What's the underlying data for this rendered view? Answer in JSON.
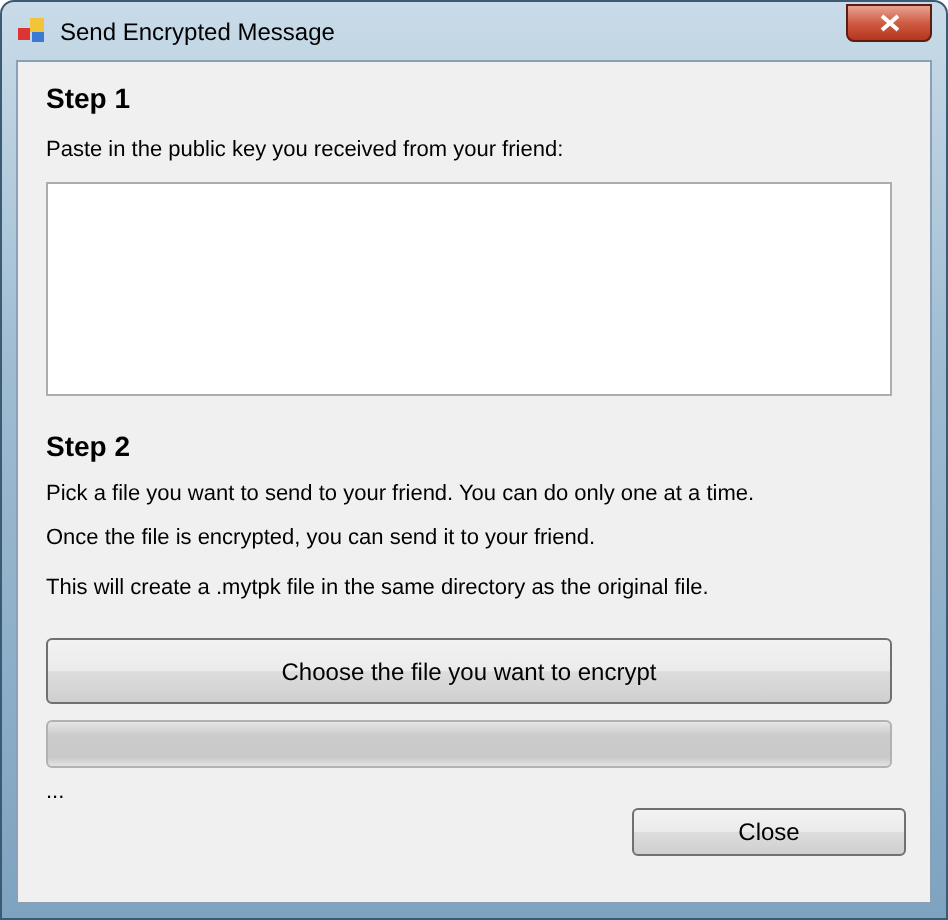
{
  "window": {
    "title": "Send Encrypted Message"
  },
  "step1": {
    "heading": "Step 1",
    "instruction": "Paste in the public key you received from your friend:"
  },
  "step2": {
    "heading": "Step 2",
    "lines": [
      "Pick a file you want to send to your friend. You can do only one at a time.",
      "Once the file is encrypted, you can send it to your friend.",
      "This will create a .mytpk file in the same directory as the original file."
    ]
  },
  "choose_button": "Choose the file you want to encrypt",
  "progress": {
    "level": 0
  },
  "status": "...",
  "close_button": "Close"
}
